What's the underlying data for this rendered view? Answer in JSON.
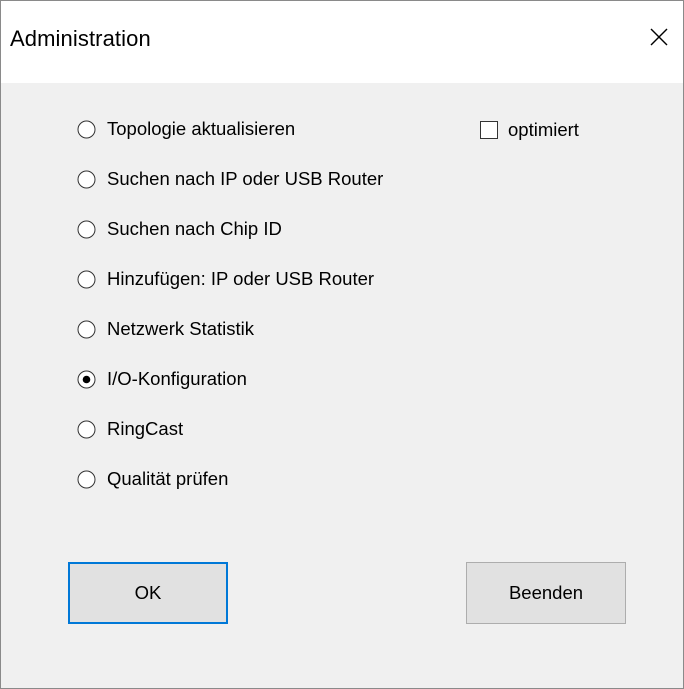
{
  "window": {
    "title": "Administration"
  },
  "options": [
    {
      "label": "Topologie aktualisieren",
      "selected": false
    },
    {
      "label": "Suchen nach IP oder USB Router",
      "selected": false
    },
    {
      "label": "Suchen nach Chip ID",
      "selected": false
    },
    {
      "label": "Hinzufügen: IP oder USB Router",
      "selected": false
    },
    {
      "label": "Netzwerk Statistik",
      "selected": false
    },
    {
      "label": "I/O-Konfiguration",
      "selected": true
    },
    {
      "label": "RingCast",
      "selected": false
    },
    {
      "label": "Qualität prüfen",
      "selected": false
    }
  ],
  "checkbox": {
    "label": "optimiert",
    "checked": false
  },
  "buttons": {
    "ok": "OK",
    "quit": "Beenden"
  }
}
